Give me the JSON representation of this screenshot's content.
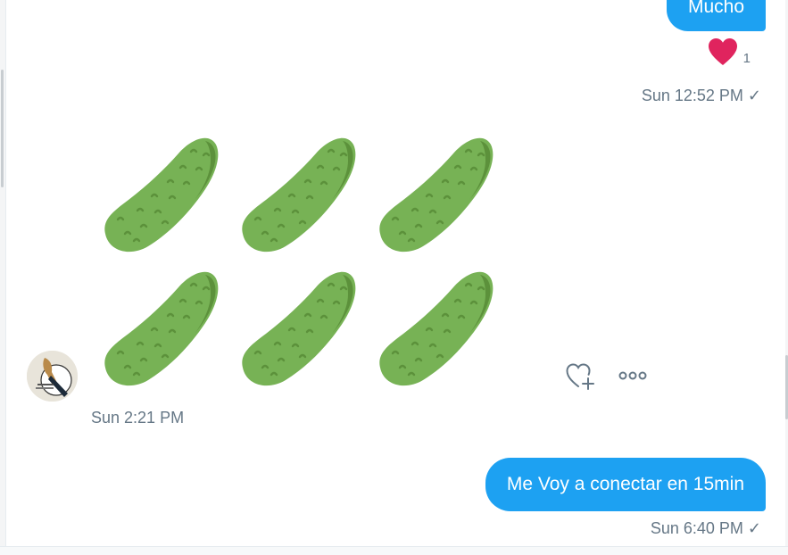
{
  "conversation": {
    "messages": [
      {
        "direction": "outgoing",
        "text": "Mucho",
        "reaction": {
          "icon": "heart-icon",
          "count": "1",
          "color": "#e0245e"
        },
        "timestamp": "Sun 12:52 PM ✓"
      },
      {
        "direction": "incoming",
        "emoji": [
          "cucumber-icon",
          "cucumber-icon",
          "cucumber-icon",
          "cucumber-icon",
          "cucumber-icon",
          "cucumber-icon"
        ],
        "timestamp": "Sun 2:21 PM"
      },
      {
        "direction": "outgoing",
        "text": "Me Voy a conectar en 15min",
        "timestamp": "Sun 6:40 PM ✓"
      }
    ]
  },
  "colors": {
    "bubble_blue": "#1da1f2",
    "timestamp_gray": "#657786",
    "heart_red": "#e0245e",
    "pickle_green": "#77b255"
  },
  "icons": {
    "add_reaction": "heart-plus-icon",
    "more_options": "more-options-icon"
  }
}
